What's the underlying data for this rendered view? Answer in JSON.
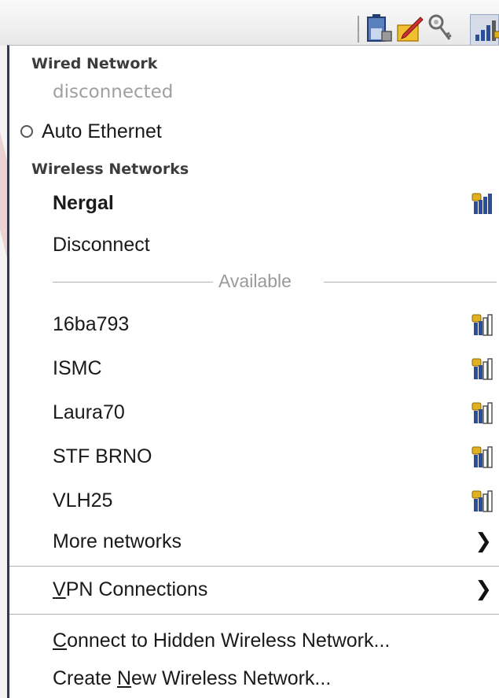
{
  "wired": {
    "heading": "Wired Network",
    "status": "disconnected",
    "connection": "Auto Ethernet"
  },
  "wireless": {
    "heading": "Wireless Networks",
    "active": "Nergal",
    "disconnect": "Disconnect",
    "available_label": "Available",
    "networks": [
      "16ba793",
      "ISMC",
      "Laura70",
      "STF BRNO",
      "VLH25"
    ],
    "more": "More networks"
  },
  "vpn": {
    "prefix": "",
    "accel": "V",
    "rest": "PN Connections"
  },
  "hidden": {
    "accel": "C",
    "rest": "onnect to Hidden Wireless Network..."
  },
  "create": {
    "prefix": "Create ",
    "accel": "N",
    "rest": "ew Wireless Network..."
  },
  "icons": {
    "tray": [
      "battery-icon",
      "notes-icon",
      "keys-icon",
      "network-icon"
    ],
    "signal": "wifi-signal-locked-icon",
    "submenu": "chevron-right-icon"
  },
  "colors": {
    "menu_border": "#2c3a58",
    "signal_blue": "#2a4e9c",
    "lock_gold": "#e0b020"
  }
}
